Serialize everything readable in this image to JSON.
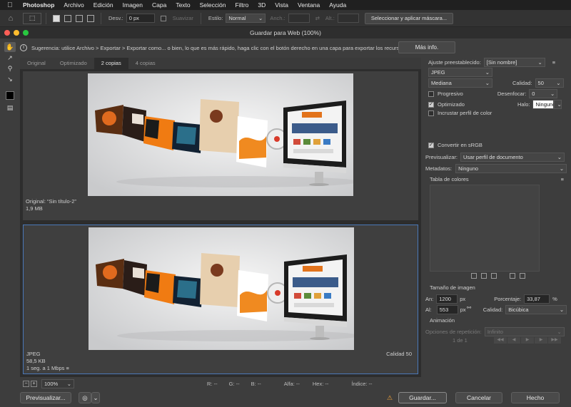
{
  "menubar": {
    "app": "Photoshop",
    "items": [
      "Archivo",
      "Edición",
      "Imagen",
      "Capa",
      "Texto",
      "Selección",
      "Filtro",
      "3D",
      "Vista",
      "Ventana",
      "Ayuda"
    ]
  },
  "options": {
    "feather_label": "Desv.:",
    "feather_value": "0 px",
    "smooth_label": "Suavizar",
    "style_label": "Estilo:",
    "style_value": "Normal",
    "width_label": "Anch.:",
    "height_label": "Alt.:",
    "select_mask_button": "Seleccionar y aplicar máscara..."
  },
  "dialog": {
    "title": "Guardar para Web (100%)",
    "tip": "Sugerencia: utilice Archivo > Exportar > Exportar como... o bien, lo que es más rápido, haga clic con el botón derecho en una capa para exportar los recursos",
    "more_info": "Más info.",
    "tabs": [
      "Original",
      "Optimizado",
      "2 copias",
      "4 copias"
    ],
    "active_tab": 2,
    "top_pane": {
      "line1": "Original: “Sin título-2”",
      "line2": "1,9 MB"
    },
    "bottom_pane": {
      "format": "JPEG",
      "size": "58,5 KB",
      "speed": "1 seg. a 1 Mbps",
      "quality": "Calidad 50"
    },
    "status": {
      "zoom": "100%",
      "r": "R: --",
      "g": "G: --",
      "b": "B: --",
      "alpha": "Alfa: --",
      "hex": "Hex: --",
      "index": "Índice: --"
    },
    "buttons": {
      "preview": "Previsualizar...",
      "save": "Guardar...",
      "cancel": "Cancelar",
      "done": "Hecho"
    }
  },
  "settings": {
    "preset_label": "Ajuste preestablecido:",
    "preset_value": "[Sin nombre]",
    "format": "JPEG",
    "compression": "Mediana",
    "quality_label": "Calidad:",
    "quality_value": "50",
    "progressive": "Progresivo",
    "blur_label": "Desenfocar:",
    "blur_value": "0",
    "optimized": "Optimizado",
    "matte_label": "Halo:",
    "matte_value": "Ninguno",
    "embed_profile": "Incrustar perfil de color",
    "convert_srgb": "Convertir en sRGB",
    "preview_label": "Previsualizar:",
    "preview_value": "Usar perfil de documento",
    "metadata_label": "Metadatos:",
    "metadata_value": "Ninguno",
    "color_table": "Tabla de colores",
    "image_size": "Tamaño de imagen",
    "width_label": "An:",
    "width_value": "1200",
    "height_label": "Al:",
    "height_value": "553",
    "unit": "px",
    "percent_label": "Porcentaje:",
    "percent_value": "33,87",
    "percent_unit": "%",
    "resample_label": "Calidad:",
    "resample_value": "Bicúbica",
    "animation": "Animación",
    "loop_label": "Opciones de repetición:",
    "loop_value": "Infinito",
    "frame": "1 de 1"
  },
  "colors": {
    "accent": "#4a78b8",
    "close": "#ff5f57",
    "minimize": "#febc2e",
    "zoom": "#28c840"
  }
}
